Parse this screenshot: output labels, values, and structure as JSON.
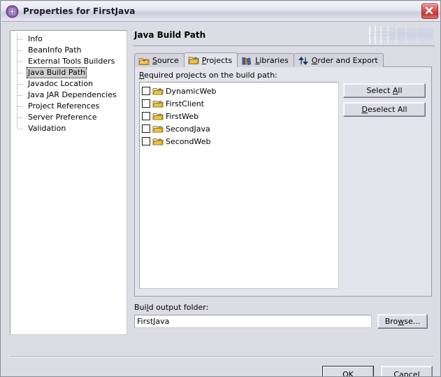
{
  "window": {
    "title": "Properties for FirstJava",
    "app_icon": "properties-globe-icon",
    "close_label": "close-icon"
  },
  "sidebar": {
    "items": [
      {
        "label": "Info",
        "selected": false
      },
      {
        "label": "BeanInfo Path",
        "selected": false
      },
      {
        "label": "External Tools Builders",
        "selected": false
      },
      {
        "label": "Java Build Path",
        "selected": true
      },
      {
        "label": "Javadoc Location",
        "selected": false
      },
      {
        "label": "Java JAR Dependencies",
        "selected": false
      },
      {
        "label": "Project References",
        "selected": false
      },
      {
        "label": "Server Preference",
        "selected": false
      },
      {
        "label": "Validation",
        "selected": false
      }
    ]
  },
  "page": {
    "title": "Java Build Path"
  },
  "tabs": [
    {
      "label": "Source",
      "mnemonic": "S",
      "icon": "source-folder-icon",
      "active": false
    },
    {
      "label": "Projects",
      "mnemonic": "P",
      "icon": "open-folder-icon",
      "active": true
    },
    {
      "label": "Libraries",
      "mnemonic": "L",
      "icon": "books-icon",
      "active": false
    },
    {
      "label": "Order and Export",
      "mnemonic": "O",
      "icon": "updown-arrows-icon",
      "active": false
    }
  ],
  "projects_tab": {
    "list_label_pre": "",
    "list_label_mnemonic": "R",
    "list_label_post": "equired projects on the build path:",
    "projects": [
      {
        "name": "DynamicWeb",
        "checked": false
      },
      {
        "name": "FirstClient",
        "checked": false
      },
      {
        "name": "FirstWeb",
        "checked": false
      },
      {
        "name": "SecondJava",
        "checked": false
      },
      {
        "name": "SecondWeb",
        "checked": false
      }
    ],
    "select_all": {
      "pre": "Select ",
      "mnemonic": "A",
      "post": "ll"
    },
    "deselect_all": {
      "pre": "",
      "mnemonic": "D",
      "post": "eselect All"
    }
  },
  "output_folder": {
    "label_pre": "Bui",
    "label_mnemonic": "l",
    "label_post": "d output folder:",
    "value": "FirstJava",
    "placeholder": "",
    "browse": {
      "pre": "Bro",
      "mnemonic": "w",
      "post": "se..."
    }
  },
  "footer": {
    "ok_label": "OK",
    "cancel_label": "Cancel"
  },
  "colors": {
    "dialog_bg": "#dcdce4",
    "panel_bg": "#e4e4ec",
    "tab_inactive": "#d4d4de",
    "border": "#9a9aac",
    "selection": "#cfcfcf",
    "close_red": "#c43434",
    "folder_yellow": "#f5cb5c",
    "banner_blue": "#b9c6e3",
    "accent_icon_purple": "#7b4f9e"
  }
}
